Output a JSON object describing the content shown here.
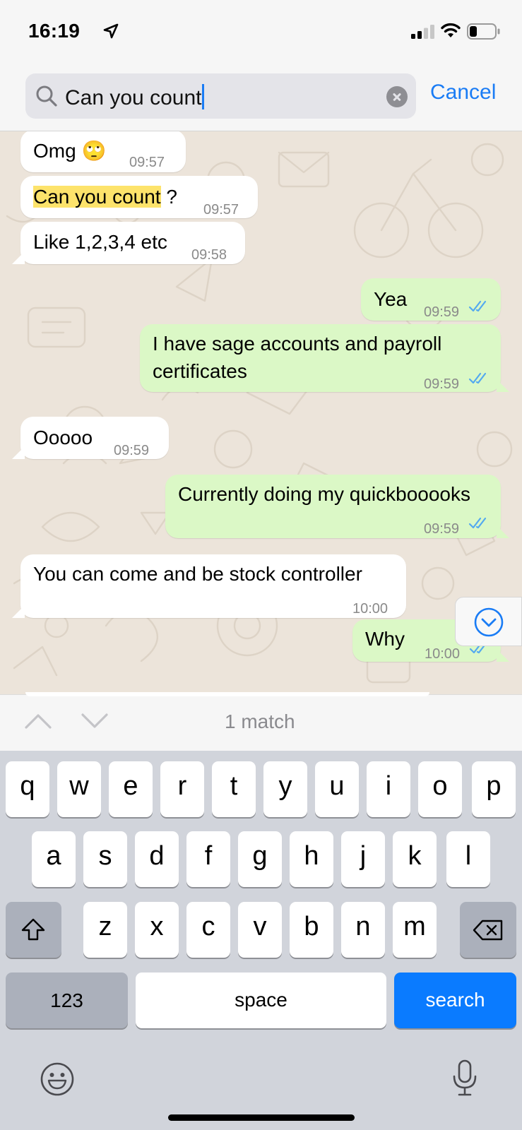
{
  "status_bar": {
    "time": "16:19"
  },
  "search": {
    "query": "Can you count",
    "cancel_label": "Cancel"
  },
  "messages": [
    {
      "dir": "in",
      "text": "Omg 🙄",
      "time": "09:57"
    },
    {
      "dir": "in",
      "text_highlight": "Can you count",
      "text_rest": " ?",
      "time": "09:57"
    },
    {
      "dir": "in",
      "text": "Like 1,2,3,4 etc",
      "time": "09:58"
    },
    {
      "dir": "out",
      "text": "Yea",
      "time": "09:59"
    },
    {
      "dir": "out",
      "line1": "I have sage accounts and payroll",
      "line2": "certificates",
      "time": "09:59"
    },
    {
      "dir": "in",
      "text": "Ooooo",
      "time": "09:59"
    },
    {
      "dir": "out",
      "text": "Currently doing my quickbooooks",
      "time": "09:59"
    },
    {
      "dir": "in",
      "text": "You can come and be stock controller",
      "time": "10:00"
    },
    {
      "dir": "out",
      "text": "Why",
      "time": "10:00"
    }
  ],
  "match_bar": {
    "count": "1 match"
  },
  "keyboard": {
    "row1": [
      "q",
      "w",
      "e",
      "r",
      "t",
      "y",
      "u",
      "i",
      "o",
      "p"
    ],
    "row2": [
      "a",
      "s",
      "d",
      "f",
      "g",
      "h",
      "j",
      "k",
      "l"
    ],
    "row3": [
      "z",
      "x",
      "c",
      "v",
      "b",
      "n",
      "m"
    ],
    "numbers_label": "123",
    "space_label": "space",
    "search_label": "search",
    "icons": [
      "shift-icon",
      "backspace-icon",
      "emoji-icon",
      "microphone-icon"
    ]
  },
  "colors": {
    "accent": "#1a7cf5",
    "outgoing": "#dbf8c6",
    "incoming": "#ffffff",
    "highlight": "#fde36b",
    "chat_bg": "#ece4da"
  }
}
